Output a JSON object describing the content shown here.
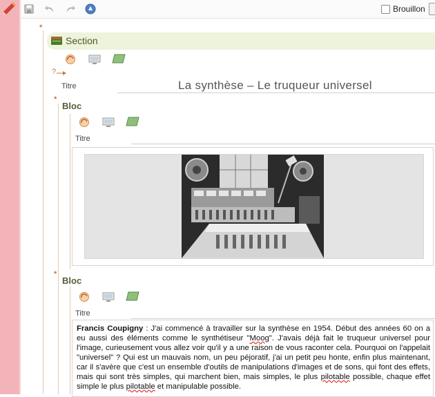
{
  "toolbar": {
    "draft_label": "Brouillon",
    "icons": [
      "edit-pencil-icon",
      "save-icon",
      "undo-icon",
      "redo-icon",
      "navigator-icon"
    ]
  },
  "section": {
    "label": "Section",
    "title_label": "Titre",
    "title": "La synthèse – Le truqueur universel",
    "marker": "?"
  },
  "blocs": [
    {
      "label": "Bloc",
      "title_label": "Titre"
    },
    {
      "label": "Bloc",
      "title_label": "Titre"
    }
  ],
  "text_block": {
    "author": "Francis Coupigny",
    "text_before": " : J'ai commencé à travailler sur la synthèse en 1954. Début des années 60 on a eu aussi des éléments comme le synthétiseur \"",
    "moog": "Moog",
    "text_middle1": "\". J'avais déjà fait le truqueur universel pour l'image, curieusement vous allez voir qu'il y a une raison de vous raconter cela. Pourquoi on l'appelait \"universel\" ? Qui est un mauvais nom, un peu péjoratif, j'ai un petit peu honte, enfin plus maintenant, car il s'avère que c'est un ensemble d'outils de manipulations d'images et de sons, qui font des effets, mais qui sont très simples, qui marchent bien, mais simples, le plus ",
    "pilotable1": "pilotable",
    "text_middle2": " possible, chaque effet simple le plus ",
    "pilotable2": "pilotable",
    "text_end": " et manipulable possible."
  },
  "colors": {
    "left_margin": "#f2b4b8",
    "section_bar": "#eef3dc",
    "accent_orange": "#c9793a"
  }
}
